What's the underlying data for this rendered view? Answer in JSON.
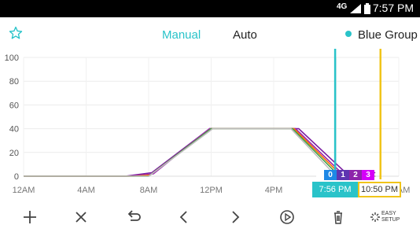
{
  "status_bar": {
    "network": "4G",
    "time": "7:57 PM"
  },
  "header": {
    "tabs": [
      {
        "label": "Manual"
      },
      {
        "label": "Auto"
      }
    ],
    "group": {
      "label": "Blue Group",
      "color": "#29c3c9"
    }
  },
  "chart_data": {
    "type": "line",
    "ylim": [
      0,
      100
    ],
    "yticks": [
      "100",
      "80",
      "60",
      "40",
      "20",
      "0"
    ],
    "xticks": [
      "12AM",
      "4AM",
      "8AM",
      "12PM",
      "4PM",
      "8PM",
      "12AM"
    ],
    "x_unit": "hours",
    "series": [
      {
        "color": "#7b1fa2",
        "x": [
          0,
          6.5,
          8.2,
          11.9,
          17.6,
          20.6,
          22.5
        ],
        "y": [
          0,
          0,
          3,
          40,
          40,
          3,
          3
        ]
      },
      {
        "color": "#9c27b0",
        "x": [
          0,
          6.7,
          8.3,
          11.9,
          17.4,
          20.4,
          22.3
        ],
        "y": [
          0,
          0,
          2,
          40,
          40,
          2,
          0
        ]
      },
      {
        "color": "#ff6d00",
        "x": [
          0,
          7.0,
          8.1,
          12.0,
          17.3,
          20.3,
          22.5
        ],
        "y": [
          0,
          0,
          1,
          40,
          40,
          1,
          0
        ]
      },
      {
        "color": "#43a047",
        "x": [
          0,
          7.3,
          8.0,
          12.0,
          17.2,
          20.2,
          22.5
        ],
        "y": [
          0,
          0,
          0,
          40,
          40,
          0,
          0
        ]
      },
      {
        "color": "#bdbdbd",
        "x": [
          0,
          7.6,
          8.0,
          12.1,
          17.1,
          20.0,
          22.5
        ],
        "y": [
          0,
          0,
          0,
          40,
          40,
          0,
          0
        ]
      }
    ],
    "markers": [
      {
        "label": "7:56 PM",
        "x": 19.93,
        "color": "#29c3c9"
      },
      {
        "label": "10:50 PM",
        "x": 22.83,
        "color": "#f0c419"
      }
    ]
  },
  "channels": [
    {
      "label": "",
      "color": "#ffffff"
    },
    {
      "label": "0",
      "color": "#1e88e5"
    },
    {
      "label": "1",
      "color": "#5e35b1"
    },
    {
      "label": "2",
      "color": "#8e24aa"
    },
    {
      "label": "3",
      "color": "#d500f9"
    }
  ],
  "toolbar": {
    "easy_setup_line1": "EASY",
    "easy_setup_line2": "SETUP",
    "icons": [
      "plus-icon",
      "close-icon",
      "undo-icon",
      "chevron-left-icon",
      "chevron-right-icon",
      "play-icon",
      "trash-icon",
      "easy-setup-icon"
    ]
  }
}
